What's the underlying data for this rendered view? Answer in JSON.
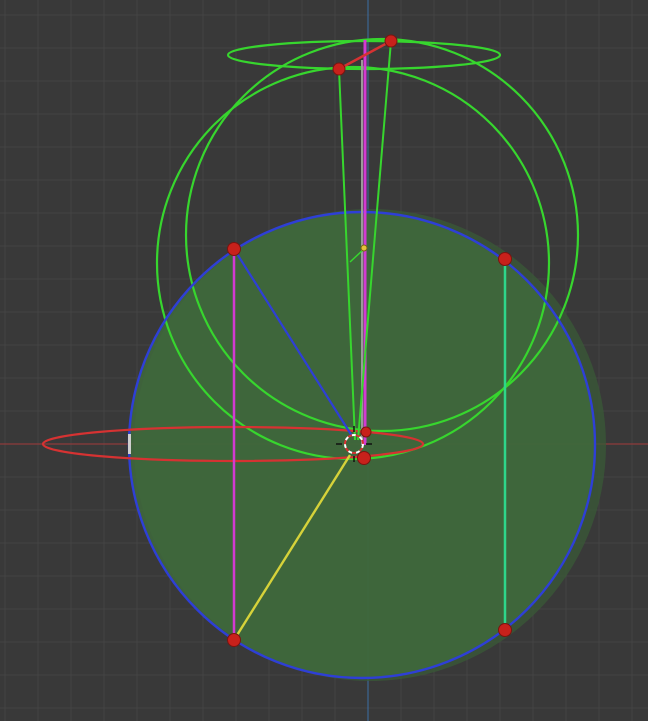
{
  "viewport": {
    "name": "3D viewport",
    "background_color": "#393939",
    "grid_minor_color": "#444444",
    "grid_major_color": "#4a4a4a",
    "x_axis_color": "#a23a3a",
    "y_axis_color": "#3b6ea5"
  },
  "gizmos": {
    "blue_circle_color": "#2e3fd6",
    "green_circle_color": "#37d62e",
    "red_ellipse_color": "#d63232",
    "magenta_line_color": "#d23ad2",
    "teal_line_color": "#2ed68a",
    "yellow_line_color": "#d6d23a",
    "sphere_fill_color": "#3f6a3c",
    "control_point_color": "#c8211b",
    "control_point_icon": "sphere-point-icon"
  },
  "cursor": {
    "icon": "3d-cursor-icon"
  }
}
